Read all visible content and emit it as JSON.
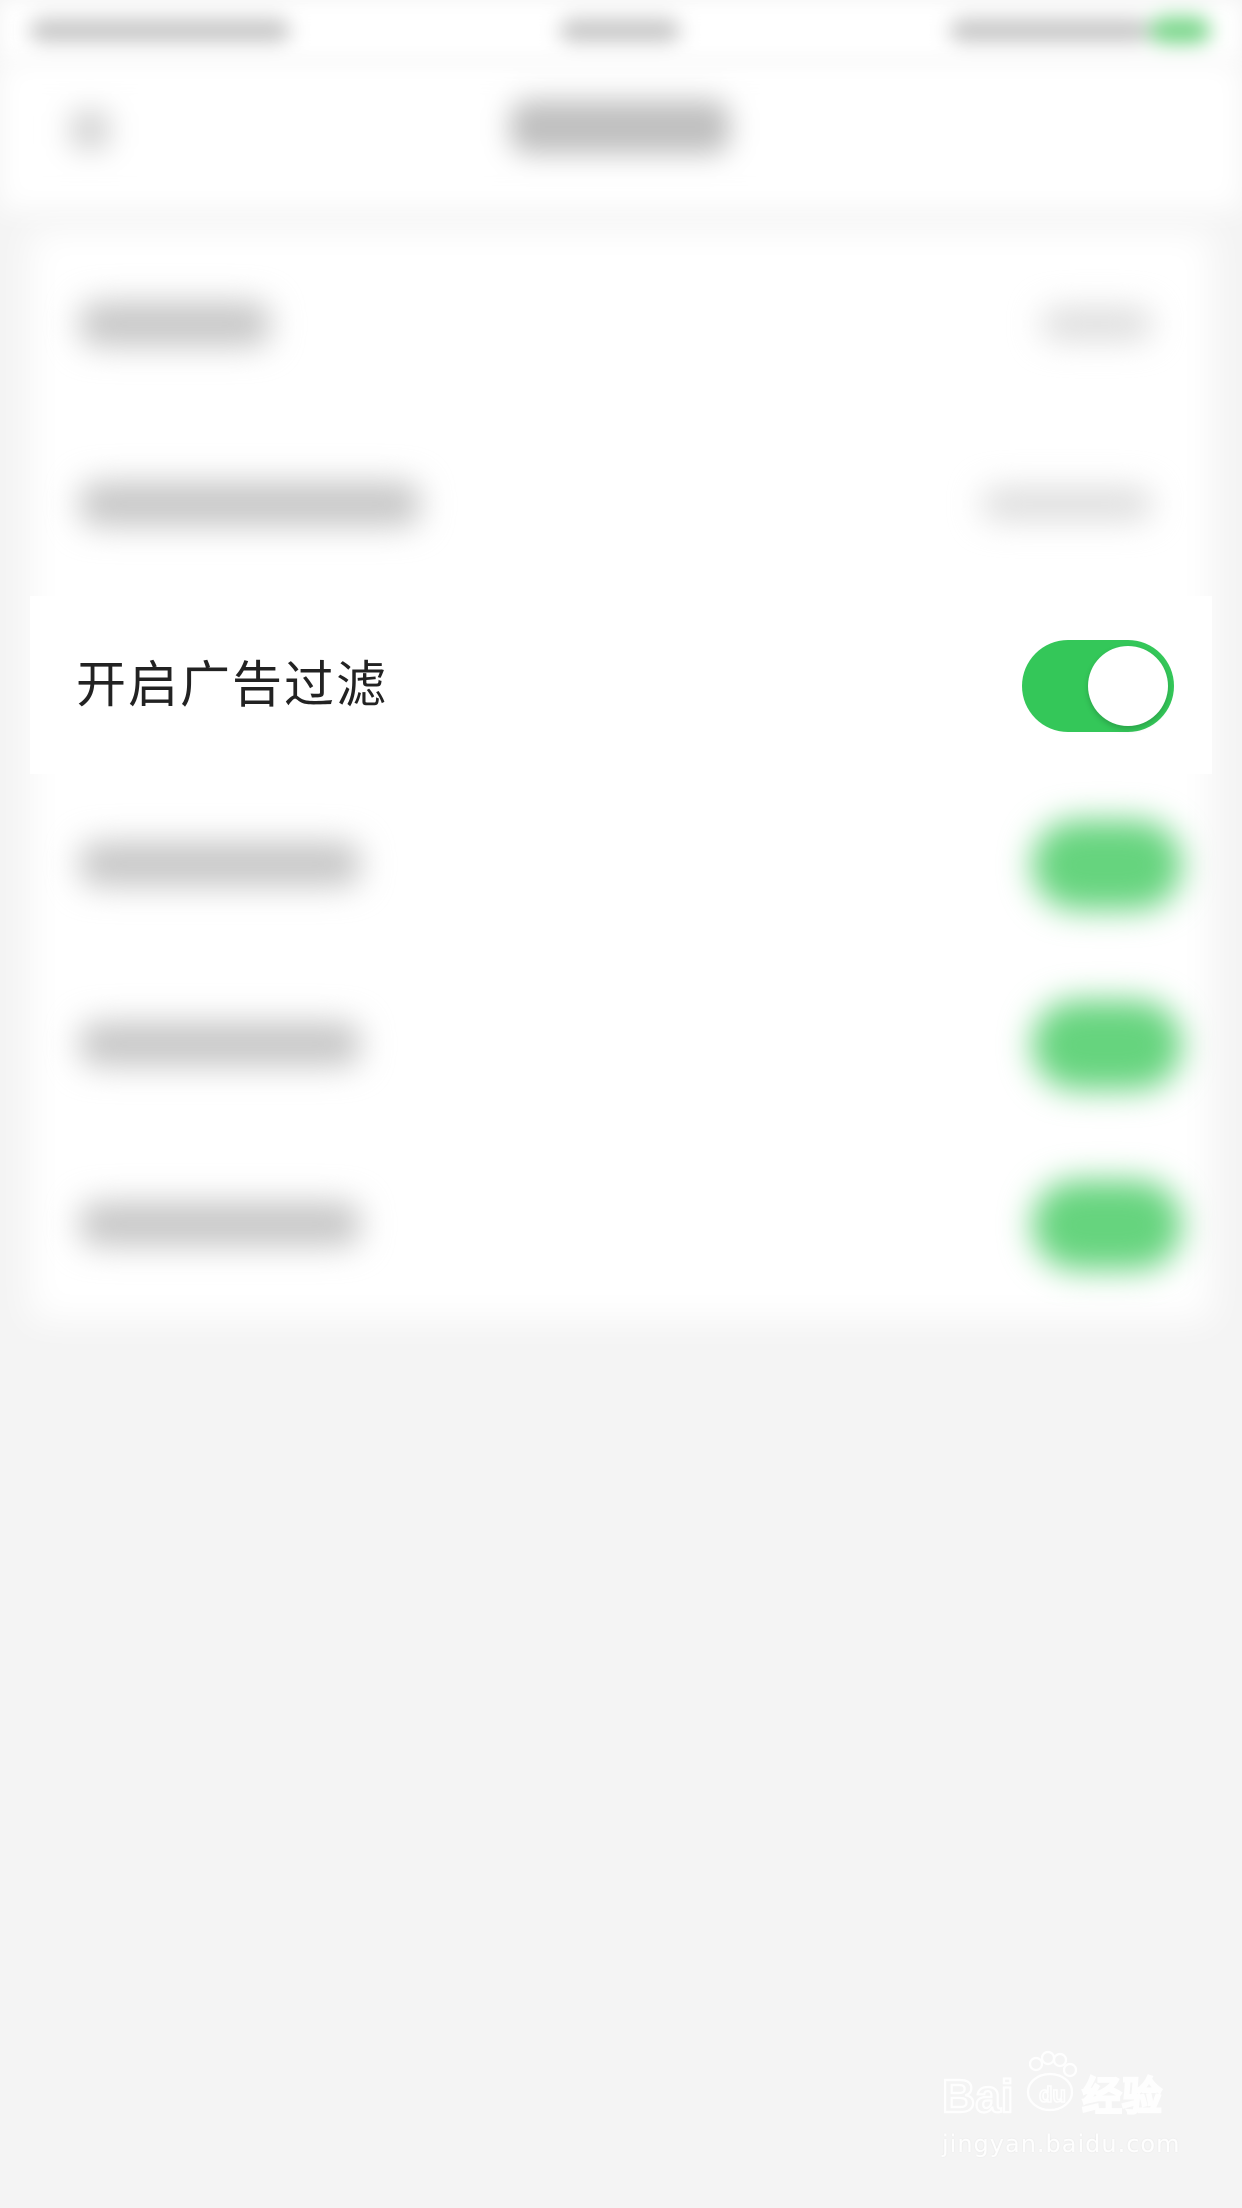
{
  "settings": {
    "ad_filter": {
      "label": "开启广告过滤",
      "enabled": true
    }
  },
  "colors": {
    "toggle_on": "#34c759",
    "background": "#f4f4f4",
    "card": "#ffffff",
    "label_text": "#222222"
  },
  "icons": {
    "back": "chevron-left-icon",
    "watermark": "baidu-paw-logo"
  },
  "watermark": {
    "url": "jingyan.baidu.com"
  }
}
